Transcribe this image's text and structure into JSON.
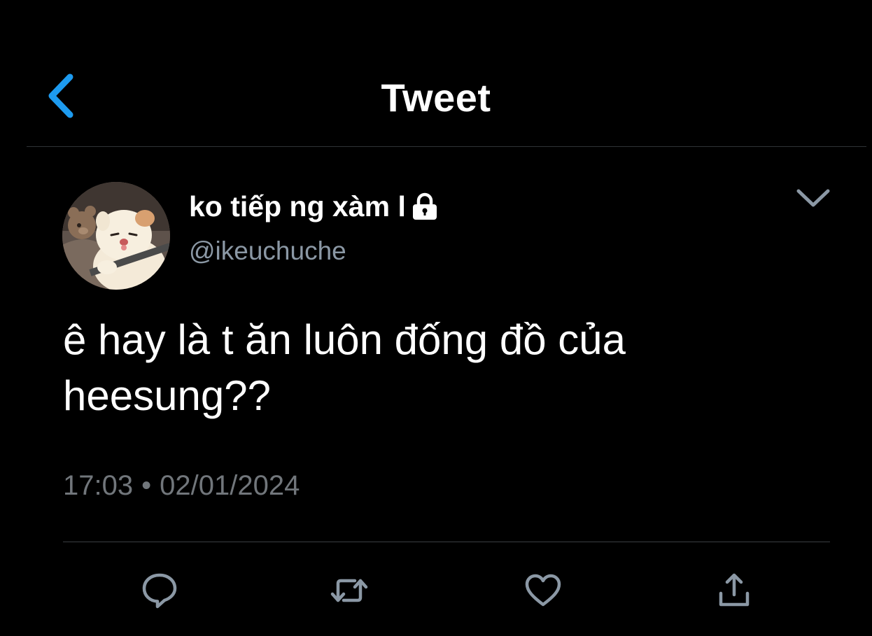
{
  "header": {
    "title": "Tweet",
    "back_icon": "chevron-left-icon",
    "accent_color": "#1d9bf0"
  },
  "author": {
    "display_name": "ko tiếp ng xàm l",
    "handle": "@ikeuchuche",
    "protected_icon": "lock-icon",
    "avatar": "avatar-illustration"
  },
  "tweet": {
    "text": "ê hay là t ăn luôn đống đồ của heesung??",
    "time": "17:03",
    "separator": "•",
    "date": "02/01/2024"
  },
  "actions": [
    {
      "name": "reply",
      "icon": "reply-icon"
    },
    {
      "name": "retweet",
      "icon": "retweet-icon"
    },
    {
      "name": "like",
      "icon": "heart-icon"
    },
    {
      "name": "share",
      "icon": "share-icon"
    }
  ],
  "colors": {
    "background": "#000000",
    "text": "#ffffff",
    "secondary_text": "#8b98a5",
    "icon": "#8b98a5",
    "divider": "#2f3336"
  }
}
